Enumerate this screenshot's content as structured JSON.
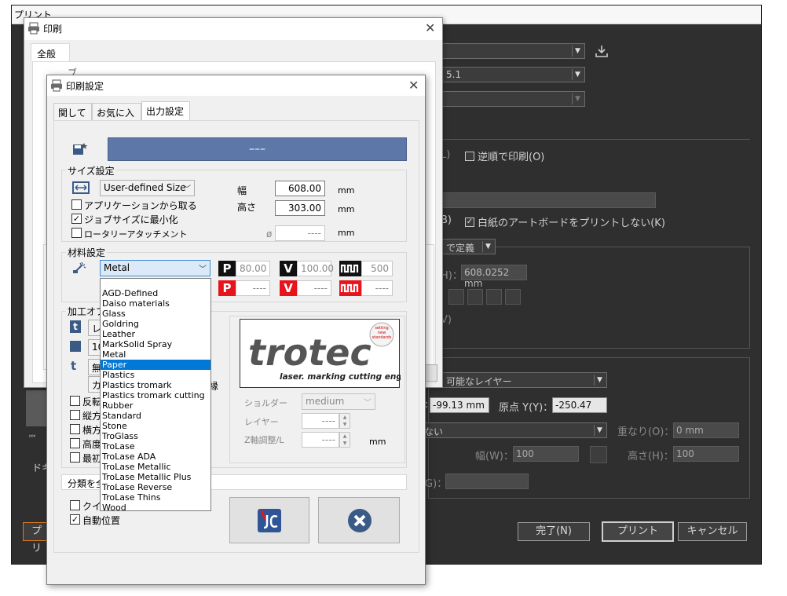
{
  "back_dialog": {
    "title": "プリント",
    "ppd_value": "5.1",
    "reverse_print_label": "逆順で印刷(O)",
    "left_checkbox_fragment": "L)",
    "skip_blank_fragment": "B)",
    "skip_blank_label": "白紙のアートボードをプリントしない(K)",
    "define_label": "で定義",
    "width_prefix": "H)：",
    "width_value": "608.0252 mm",
    "v_fragment": "V)",
    "layer_select": "可能なレイヤー",
    "x_value": "-99.13 mm",
    "origin_y_label": "原点 Y(Y)：",
    "y_value": "-250.47 mr",
    "scale_fragment": "ない",
    "overlap_label": "重なり(O)：",
    "overlap_value": "0 mm",
    "w_label": "幅(W)：",
    "w_value": "100",
    "h_label": "高さ(H)：",
    "h_value": "100",
    "g_fragment": "G)：",
    "doc_fragment": "ドキ",
    "print_left_fragment": "プリ",
    "done_label": "完了(N)",
    "print_label": "プリント",
    "cancel_label": "キャンセル"
  },
  "print_dialog": {
    "title": "印刷",
    "tab_general": "全般",
    "fragment_label": "ブ"
  },
  "settings_dialog": {
    "title": "印刷設定",
    "tabs": [
      "関して",
      "お気に入り",
      "出力設定"
    ],
    "banner_text": "–––",
    "size_group": "サイズ設定",
    "size_combo": "User-defined Size",
    "width_label": "幅",
    "width_value": "608.00",
    "height_label": "高さ",
    "height_value": "303.00",
    "unit_mm": "mm",
    "from_app_label": "アプリケーションから取る",
    "minimize_job_label": "ジョブサイズに最小化",
    "rotary_label": "ロータリーアタッチメント",
    "diameter_symbol": "ø",
    "diameter_value": "----",
    "material_group": "材料設定",
    "material_value": "Metal",
    "p_row1": "80.00",
    "v_row1": "100.00",
    "hz_row1": "500",
    "p_row2": "----",
    "v_row2": "----",
    "hz_row2": "----",
    "process_group": "加工オプ",
    "chk_labels": [
      "反転",
      "縦方",
      "横方",
      "高度",
      "最初"
    ],
    "left_field_fragments": [
      "レ",
      "10",
      "無",
      "カ"
    ],
    "edge_fragment": "縁",
    "shoulder_label": "ショルダー",
    "shoulder_value": "medium",
    "layer_label": "レイヤー",
    "layer_value": "----",
    "z_label": "Z軸調整/L",
    "z_value": "----",
    "z_unit": "mm",
    "classify_label": "分類を全",
    "quick_label": "クイッ",
    "auto_pos_label": "自動位置",
    "logo_text": "trotec",
    "logo_tagline": "laser. marking cutting engraving",
    "logo_badge": "setting new standards",
    "material_options": [
      "AGD-Defined",
      "Daiso materials",
      "Glass",
      "Goldring",
      "Leather",
      "MarkSolid Spray",
      "Metal",
      "Paper",
      "Plastics",
      "Plastics tromark",
      "Plastics tromark cutting",
      "Rubber",
      "Standard",
      "Stone",
      "TroGlass",
      "TroLase",
      "TroLase ADA",
      "TroLase Metallic",
      "TroLase Metallic Plus",
      "TroLase Reverse",
      "TroLase Thins",
      "Wood"
    ],
    "selected_option": "Paper",
    "icons": {
      "p": "P",
      "v": "V"
    }
  },
  "colors": {
    "banner": "#5d77a9",
    "red": "#e8141c",
    "dark_bg": "#2f2f2f",
    "selection": "#0078d7"
  }
}
